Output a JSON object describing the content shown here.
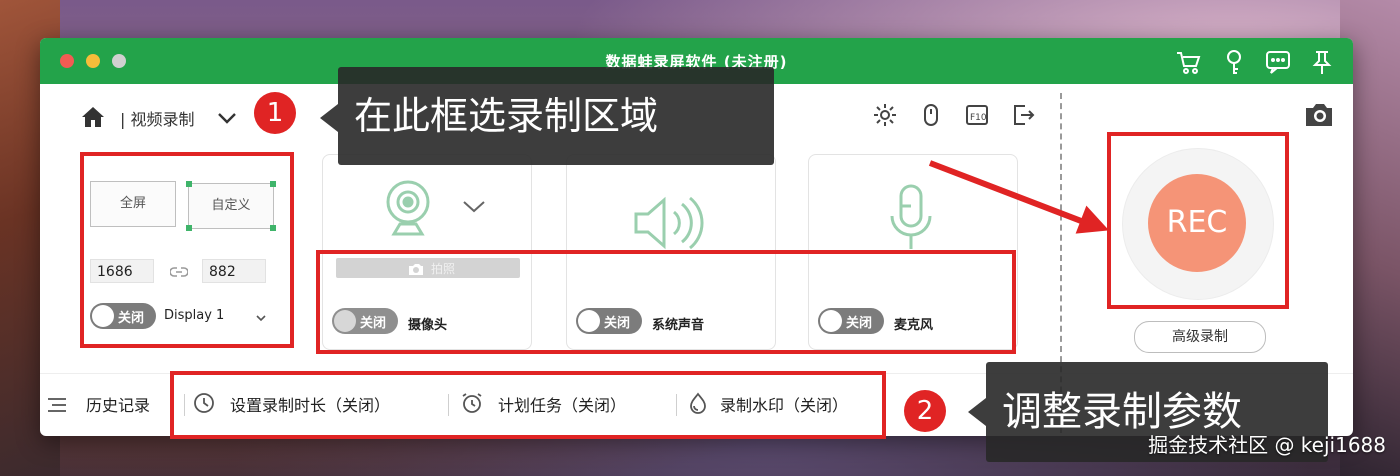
{
  "window": {
    "title": "数据蛙录屏软件 (未注册)"
  },
  "header": {
    "mode_label": "| 视频录制"
  },
  "region": {
    "fullscreen_label": "全屏",
    "custom_label": "自定义",
    "width": "1686",
    "height": "882",
    "toggle_label": "关闭",
    "display_label": "Display 1"
  },
  "camera": {
    "snapshot_label": "拍照",
    "toggle_label": "关闭",
    "label": "摄像头"
  },
  "system_audio": {
    "toggle_label": "关闭",
    "label": "系统声音"
  },
  "microphone": {
    "toggle_label": "关闭",
    "label": "麦克风"
  },
  "recorder": {
    "rec_label": "REC",
    "advanced_label": "高级录制"
  },
  "bottom": {
    "history_label": "历史记录",
    "duration_label": "设置录制时长（关闭）",
    "schedule_label": "计划任务（关闭）",
    "watermark_label": "录制水印（关闭）"
  },
  "annotations": {
    "badge1": "1",
    "callout1": "在此框选录制区域",
    "badge2": "2",
    "callout2": "调整录制参数",
    "color": "#e02424"
  },
  "watermark": {
    "text": "掘金技术社区 @ keji1688"
  },
  "colors": {
    "titlebar": "#23a34a",
    "rec": "#f59477",
    "icon_green": "#9acfae"
  }
}
